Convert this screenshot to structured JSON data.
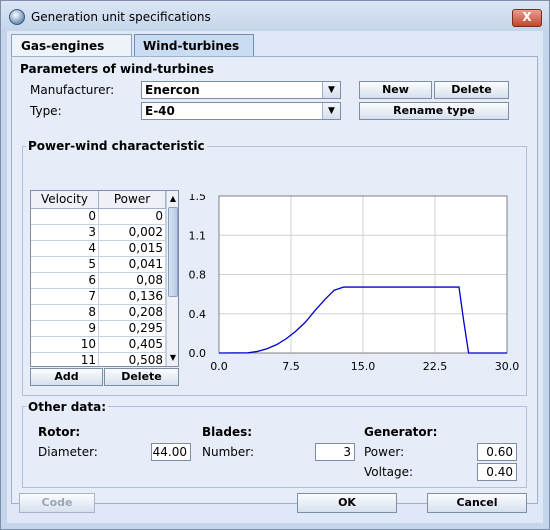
{
  "window": {
    "title": "Generation unit specifications",
    "close_label": "X"
  },
  "tabs": [
    {
      "label": "Gas-engines"
    },
    {
      "label": "Wind-turbines"
    }
  ],
  "params": {
    "legend": "Parameters of wind-turbines",
    "manufacturer_label": "Manufacturer:",
    "manufacturer_value": "Enercon",
    "type_label": "Type:",
    "type_value": "E-40",
    "new_label": "New",
    "delete_label": "Delete",
    "rename_label": "Rename type"
  },
  "power_wind": {
    "legend": "Power-wind characteristic",
    "headers": [
      "Velocity",
      "Power"
    ],
    "rows": [
      [
        "0",
        "0"
      ],
      [
        "3",
        "0,002"
      ],
      [
        "4",
        "0,015"
      ],
      [
        "5",
        "0,041"
      ],
      [
        "6",
        "0,08"
      ],
      [
        "7",
        "0,136"
      ],
      [
        "8",
        "0,208"
      ],
      [
        "9",
        "0,295"
      ],
      [
        "10",
        "0,405"
      ],
      [
        "11",
        "0,508"
      ]
    ],
    "add_label": "Add",
    "delete_label": "Delete"
  },
  "chart_data": {
    "type": "line",
    "title": "",
    "xlabel": "",
    "ylabel": "",
    "xlim": [
      0,
      30
    ],
    "ylim": [
      0,
      1.5
    ],
    "x_ticks": [
      "0.0",
      "7.5",
      "15.0",
      "22.5",
      "30.0"
    ],
    "y_ticks": [
      "1.5",
      "1.1",
      "0.8",
      "0.4",
      "0.0"
    ],
    "grid": true,
    "color": "#0000cc",
    "series": [
      {
        "x": [
          0,
          3,
          4,
          5,
          6,
          7,
          8,
          9,
          10,
          11,
          12,
          13,
          14,
          15,
          16,
          17,
          18,
          19,
          20,
          21,
          22,
          23,
          24,
          25,
          25.5,
          26,
          30
        ],
        "y": [
          0,
          0.002,
          0.015,
          0.041,
          0.08,
          0.136,
          0.208,
          0.295,
          0.405,
          0.508,
          0.6,
          0.63,
          0.63,
          0.63,
          0.63,
          0.63,
          0.63,
          0.63,
          0.63,
          0.63,
          0.63,
          0.63,
          0.63,
          0.63,
          0.3,
          0,
          0
        ]
      }
    ]
  },
  "other": {
    "legend": "Other data:",
    "rotor_label": "Rotor:",
    "diameter_label": "Diameter:",
    "diameter_value": "44.00",
    "blades_label": "Blades:",
    "number_label": "Number:",
    "number_value": "3",
    "generator_label": "Generator:",
    "power_label": "Power:",
    "power_value": "0.60",
    "voltage_label": "Voltage:",
    "voltage_value": "0.40"
  },
  "footer": {
    "code_label": "Code",
    "ok_label": "OK",
    "cancel_label": "Cancel"
  }
}
